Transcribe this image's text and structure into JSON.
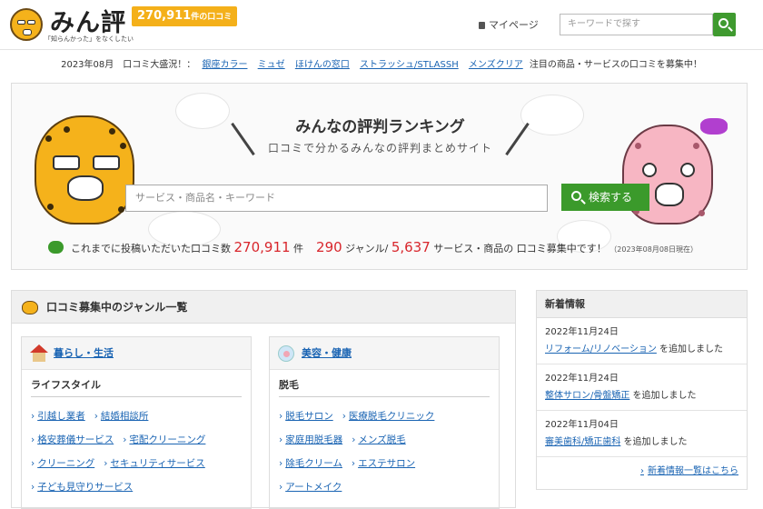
{
  "header": {
    "logo_text": "みん評",
    "logo_tagline": "「知らんかった」をなくしたい",
    "review_count_number": "270,911",
    "review_count_suffix": "件の口コミ",
    "mypage_label": "マイページ",
    "search_placeholder": "キーワードで探す"
  },
  "ticker": {
    "prefix": "2023年08月　口コミ大盛況！：",
    "links": [
      "銀座カラー",
      "ミュゼ",
      "ほけんの窓口",
      "ストラッシュ/STLASSH",
      "メンズクリア"
    ],
    "suffix": "注目の商品・サービスの口コミを募集中！"
  },
  "hero": {
    "title": "みんなの評判ランキング",
    "subtitle": "口コミで分かるみんなの評判まとめサイト",
    "search_placeholder": "サービス・商品名・キーワード",
    "search_button": "検索する",
    "stats_prefix": "これまでに投稿いただいた口コミ数",
    "stats_reviews": "270,911",
    "stats_reviews_unit": "件",
    "stats_genres": "290",
    "stats_genres_unit": "ジャンル/",
    "stats_services": "5,637",
    "stats_services_unit": "サービス・商品の 口コミ募集中です！",
    "stats_date": "（2023年08月08日現在）"
  },
  "genres": {
    "heading": "口コミ募集中のジャンル一覧",
    "categories": [
      {
        "title": "暮らし・生活",
        "subcategory": "ライフスタイル",
        "links": [
          [
            "引越し業者",
            "結婚相談所"
          ],
          [
            "格安葬儀サービス",
            "宅配クリーニング"
          ],
          [
            "クリーニング",
            "セキュリティサービス"
          ],
          [
            "子ども見守りサービス"
          ]
        ]
      },
      {
        "title": "美容・健康",
        "subcategory": "脱毛",
        "links": [
          [
            "脱毛サロン",
            "医療脱毛クリニック"
          ],
          [
            "家庭用脱毛器",
            "メンズ脱毛"
          ],
          [
            "除毛クリーム",
            "エステサロン"
          ],
          [
            "アートメイク"
          ]
        ]
      }
    ]
  },
  "news": {
    "heading": "新着情報",
    "items": [
      {
        "date": "2022年11月24日",
        "link": "リフォーム/リノベーション",
        "suffix": " を追加しました"
      },
      {
        "date": "2022年11月24日",
        "link": "整体サロン/骨盤矯正",
        "suffix": " を追加しました"
      },
      {
        "date": "2022年11月04日",
        "link": "審美歯科/矯正歯科",
        "suffix": " を追加しました"
      }
    ],
    "more_link": "新着情報一覧はこちら"
  },
  "colors": {
    "accent_green": "#3b9a2b",
    "badge_orange": "#f4b01a",
    "link_blue": "#1a64b3",
    "stat_red": "#d8262c"
  }
}
